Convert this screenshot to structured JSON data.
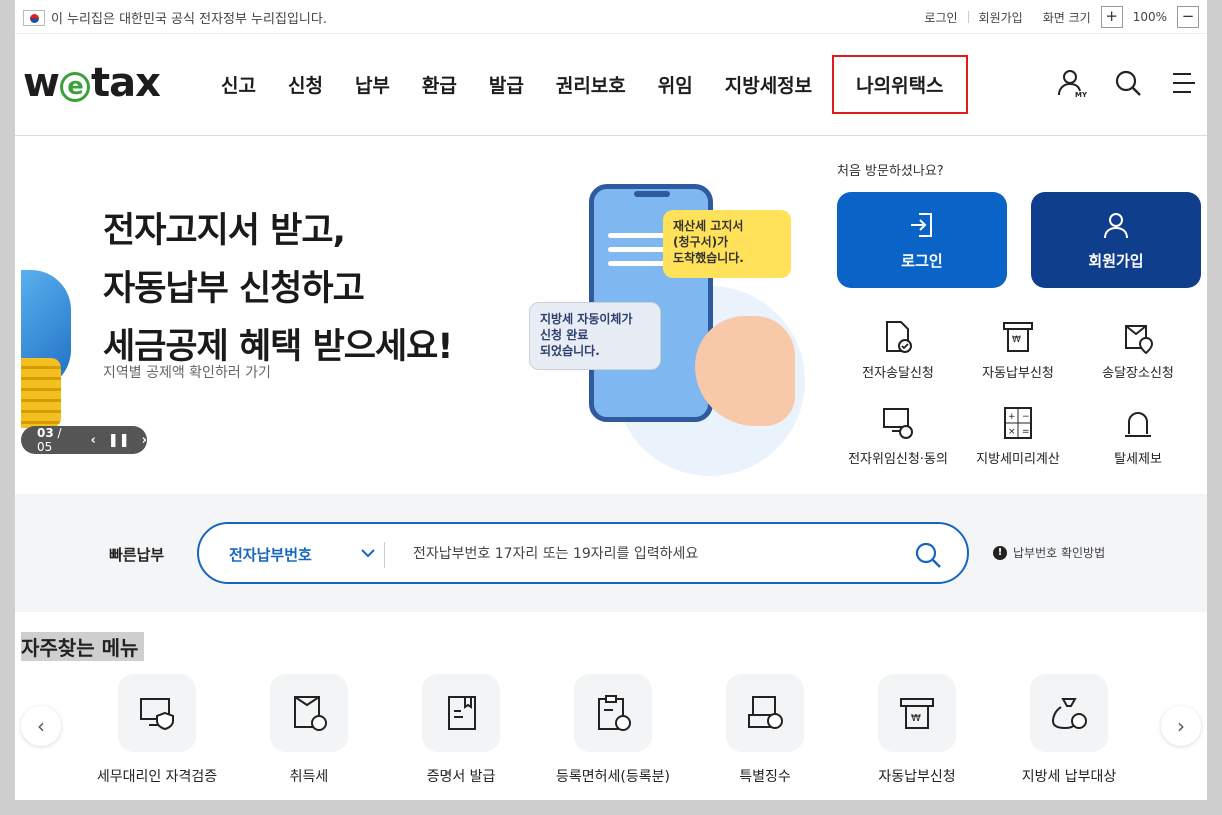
{
  "topbar": {
    "gov_notice": "이 누리집은 대한민국 공식 전자정부 누리집입니다.",
    "links": {
      "login": "로그인",
      "join": "회원가입",
      "zoom_label": "화면 크기",
      "zoom_plus": "+",
      "zoom_value": "100%",
      "zoom_minus": "−"
    }
  },
  "gnb": {
    "logo": {
      "w": "w",
      "e": "e",
      "tax": "tax"
    },
    "menu": [
      "신고",
      "신청",
      "납부",
      "환급",
      "발급",
      "권리보호",
      "위임",
      "지방세정보",
      "나의위택스"
    ],
    "icons": [
      "my-user-icon",
      "search-icon",
      "hamburger-menu-icon"
    ],
    "my_label": "MY"
  },
  "hero": {
    "headline": [
      "전자고지서 받고,",
      "자동납부 신청하고",
      "세금공제 혜택 받으세요!"
    ],
    "sub": "지역별 공제액 확인하러 가기",
    "pager": {
      "current": "03",
      "total": "/ 05"
    },
    "bubble_yellow": [
      "재산세 고지서",
      "(청구서)가",
      "도착했습니다."
    ],
    "bubble_gray": [
      "지방세 자동이체가",
      "신청 완료",
      "되었습니다."
    ]
  },
  "side": {
    "visitor_text": "처음 방문하셨나요?",
    "login_btn": "로그인",
    "join_btn": "회원가입",
    "quick": [
      "전자송달신청",
      "자동납부신청",
      "송달장소신청",
      "전자위임신청·동의",
      "지방세미리계산",
      "탈세제보"
    ]
  },
  "quickpay": {
    "label": "빠른납부",
    "select_value": "전자납부번호",
    "placeholder": "전자납부번호 17자리 또는 19자리를 입력하세요",
    "help": "납부번호 확인방법"
  },
  "frequent": {
    "title": "자주찾는 메뉴",
    "items": [
      "세무대리인 자격검증",
      "취득세",
      "증명서 발급",
      "등록면허세(등록분)",
      "특별징수",
      "자동납부신청",
      "지방세 납부대상"
    ]
  },
  "colors": {
    "primary": "#0a64c8",
    "navy": "#0f3f8c",
    "highlight": "#e01c1c",
    "logo_green": "#3aa03a"
  }
}
